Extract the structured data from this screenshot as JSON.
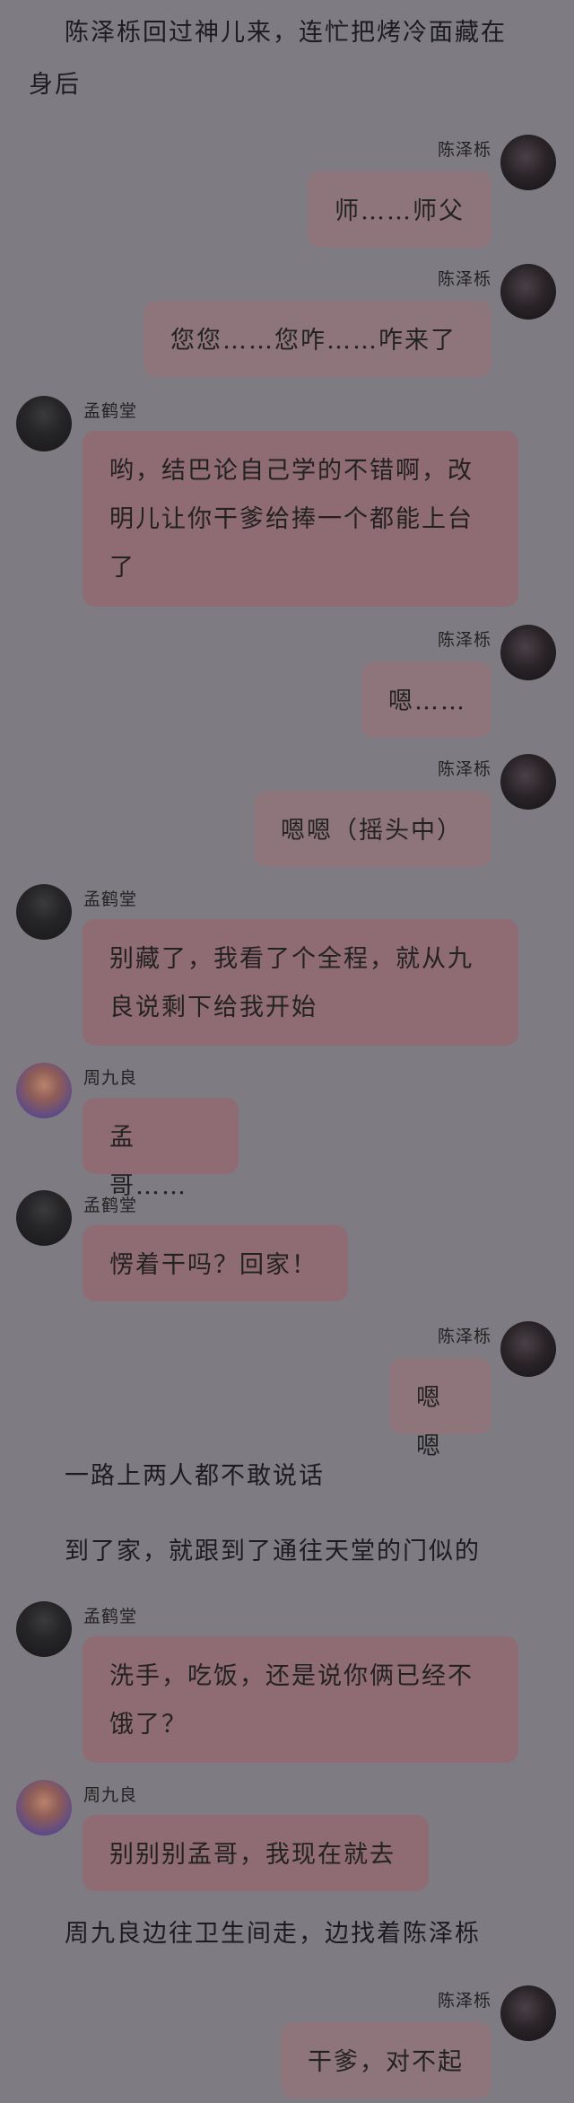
{
  "narration": {
    "n1_line1": "陈泽栎回过神儿来，连忙把烤冷面藏在",
    "n1_line2": "身后",
    "n2": "一路上两人都不敢说话",
    "n3": "到了家，就跟到了通往天堂的门似的",
    "n4": "周九良边往卫生间走，边找着陈泽栎"
  },
  "names": {
    "chen": "陈泽栎",
    "meng": "孟鹤堂",
    "zhou": "周九良"
  },
  "messages": [
    {
      "speaker": "chen",
      "side": "right",
      "lines": [
        "师……师父"
      ]
    },
    {
      "speaker": "chen",
      "side": "right",
      "lines": [
        "您您……您咋……咋来了"
      ]
    },
    {
      "speaker": "meng",
      "side": "left",
      "lines": [
        "哟，结巴论自己学的不错啊，改",
        "明儿让你干爹给捧一个都能上台",
        "了"
      ]
    },
    {
      "speaker": "chen",
      "side": "right",
      "lines": [
        "嗯……"
      ]
    },
    {
      "speaker": "chen",
      "side": "right",
      "lines": [
        "嗯嗯（摇头中）"
      ]
    },
    {
      "speaker": "meng",
      "side": "left",
      "lines": [
        "别藏了，我看了个全程，就从九",
        "良说剩下给我开始"
      ]
    },
    {
      "speaker": "zhou",
      "side": "left",
      "lines": [
        "孟哥……"
      ]
    },
    {
      "speaker": "meng",
      "side": "left",
      "lines": [
        "愣着干吗？回家！"
      ]
    },
    {
      "speaker": "chen",
      "side": "right",
      "lines": [
        "嗯嗯"
      ]
    },
    {
      "speaker": "meng",
      "side": "left",
      "lines": [
        "洗手，吃饭，还是说你俩已经不",
        "饿了？"
      ]
    },
    {
      "speaker": "zhou",
      "side": "left",
      "lines": [
        "别别别孟哥，我现在就去"
      ]
    },
    {
      "speaker": "chen",
      "side": "right",
      "lines": [
        "干爹，对不起"
      ]
    }
  ]
}
